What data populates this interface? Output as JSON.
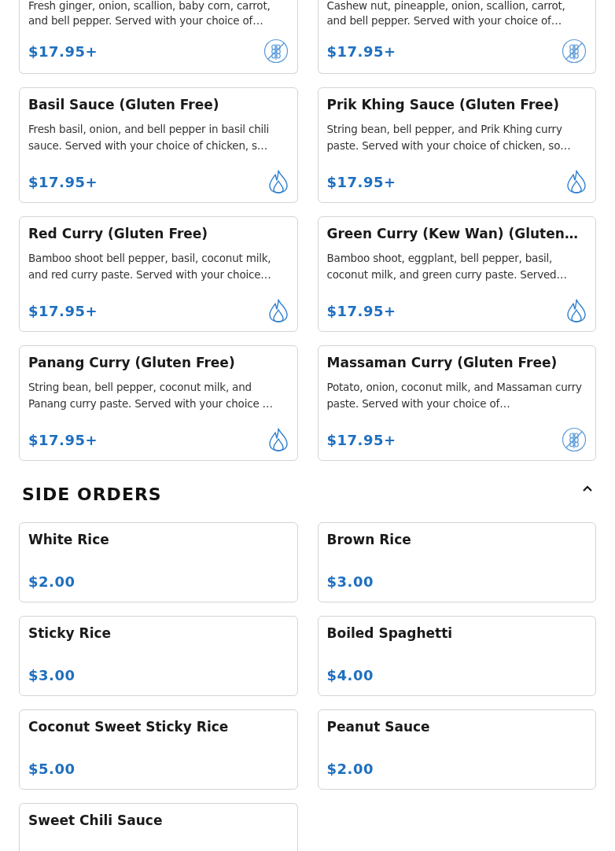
{
  "top_items": [
    {
      "description": "Fresh ginger, onion, scallion, baby corn, carrot, and bell pepper. Served with your choice of…",
      "price": "$17.95+",
      "kind": "gluten_free"
    },
    {
      "description": "Cashew nut, pineapple, onion, scallion, carrot, and bell pepper. Served with your choice of…",
      "price": "$17.95+",
      "kind": "gluten_free"
    }
  ],
  "menu_items": [
    {
      "name": "Basil Sauce (Gluten Free)",
      "description": "Fresh basil, onion, and bell pepper in basil chili sauce. Served with your choice of chicken, s…",
      "price": "$17.95+",
      "kind": "spicy"
    },
    {
      "name": "Prik Khing Sauce (Gluten Free)",
      "description": "String bean, bell pepper, and Prik Khing curry paste. Served with your choice of chicken, so…",
      "price": "$17.95+",
      "kind": "spicy"
    },
    {
      "name": "Red Curry (Gluten Free)",
      "description": "Bamboo shoot bell pepper, basil, coconut milk, and red curry paste. Served with your choice…",
      "price": "$17.95+",
      "kind": "spicy"
    },
    {
      "name": "Green Curry (Kew Wan) (Gluten…",
      "description": "Bamboo shoot, eggplant, bell pepper, basil, coconut milk, and green curry paste. Served…",
      "price": "$17.95+",
      "kind": "spicy"
    },
    {
      "name": "Panang Curry (Gluten Free)",
      "description": "String bean, bell pepper, coconut milk, and Panang curry paste. Served with your choice …",
      "price": "$17.95+",
      "kind": "spicy"
    },
    {
      "name": "Massaman Curry (Gluten Free)",
      "description": "Potato, onion, coconut milk, and Massaman curry paste. Served with your choice of…",
      "price": "$17.95+",
      "kind": "gluten_free"
    }
  ],
  "side_orders": {
    "title": "SIDE ORDERS",
    "expanded": true,
    "items": [
      {
        "name": "White Rice",
        "price": "$2.00"
      },
      {
        "name": "Brown Rice",
        "price": "$3.00"
      },
      {
        "name": "Sticky Rice",
        "price": "$3.00"
      },
      {
        "name": "Boiled Spaghetti",
        "price": "$4.00"
      },
      {
        "name": "Coconut Sweet Sticky Rice",
        "price": "$5.00"
      },
      {
        "name": "Peanut Sauce",
        "price": "$2.00"
      },
      {
        "name": "Sweet Chili Sauce"
      }
    ]
  }
}
